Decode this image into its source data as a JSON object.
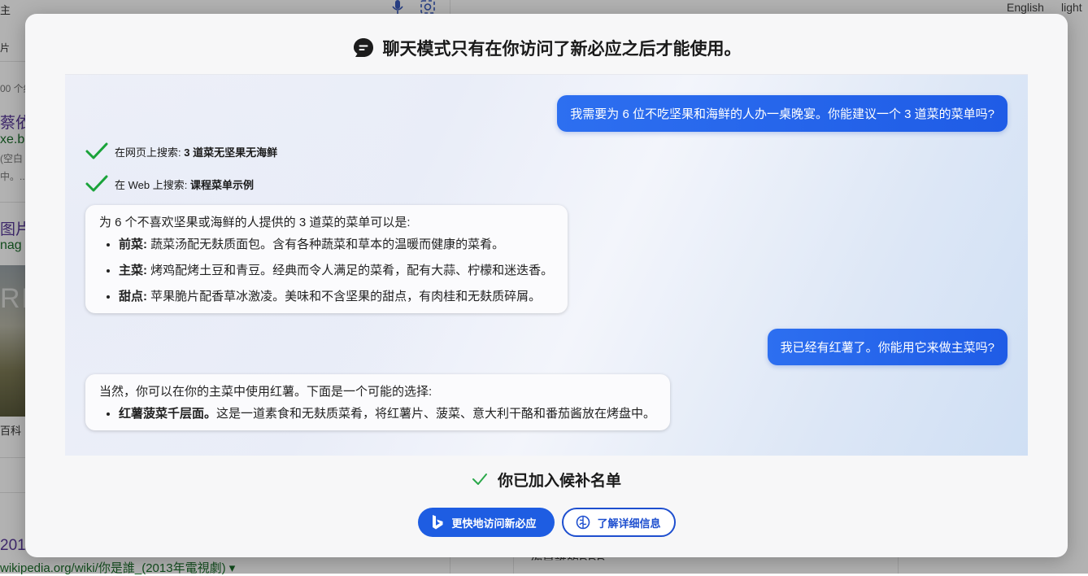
{
  "background": {
    "top_left_char": "主",
    "tab_fragment": "片",
    "result_count": "00 个结",
    "result_title": "蔡依",
    "result_url": "xe.ba",
    "result_snippet_1": "(空白",
    "result_snippet_2": "中。..",
    "images_title": "图片",
    "images_url": "nag",
    "image_overlay_text": "RE",
    "baike_label": "百科",
    "year_fragment": "201",
    "wiki_url": "wikipedia.org/wiki/你是誰_(2013年電視劇) ▾",
    "bottom_fragment": "你是誰的RRR",
    "lang_link": "English",
    "theme_link": "light"
  },
  "modal": {
    "title": "聊天模式只有在你访问了新必应之后才能使用。",
    "conversation": {
      "user_msg_1": "我需要为 6 位不吃坚果和海鲜的人办一桌晚宴。你能建议一个 3 道菜的菜单吗?",
      "search_1": {
        "prefix": "在网页上搜索: ",
        "query": "3 道菜无坚果无海鲜"
      },
      "search_2": {
        "prefix": "在 Web 上搜索: ",
        "query": "课程菜单示例"
      },
      "bot_msg_1": {
        "intro": "为 6 个不喜欢坚果或海鲜的人提供的 3 道菜的菜单可以是:",
        "items": [
          {
            "label": "前菜:",
            "text": " 蔬菜汤配无麸质面包。含有各种蔬菜和草本的温暖而健康的菜肴。"
          },
          {
            "label": "主菜:",
            "text": " 烤鸡配烤土豆和青豆。经典而令人满足的菜肴，配有大蒜、柠檬和迷迭香。"
          },
          {
            "label": "甜点:",
            "text": " 苹果脆片配香草冰激凌。美味和不含坚果的甜点，有肉桂和无麸质碎屑。"
          }
        ]
      },
      "user_msg_2": "我已经有红薯了。你能用它来做主菜吗?",
      "bot_msg_2": {
        "intro": "当然，你可以在你的主菜中使用红薯。下面是一个可能的选择:",
        "items": [
          {
            "label": "红薯菠菜千层面。",
            "text": "这是一道素食和无麸质菜肴，将红薯片、菠菜、意大利干酪和番茄酱放在烤盘中。"
          }
        ]
      }
    },
    "waitlist_text": "你已加入候补名单",
    "primary_button": "更快地访问新必应",
    "secondary_button": "了解详细信息"
  },
  "colors": {
    "accent_blue": "#1e5de2",
    "check_green": "#1aa33a",
    "overlay": "rgba(0,0,0,0.30)"
  },
  "icons": [
    "chat-bubble-icon",
    "check-icon",
    "bing-logo-icon",
    "brain-icon",
    "microphone-icon",
    "camera-icon"
  ]
}
